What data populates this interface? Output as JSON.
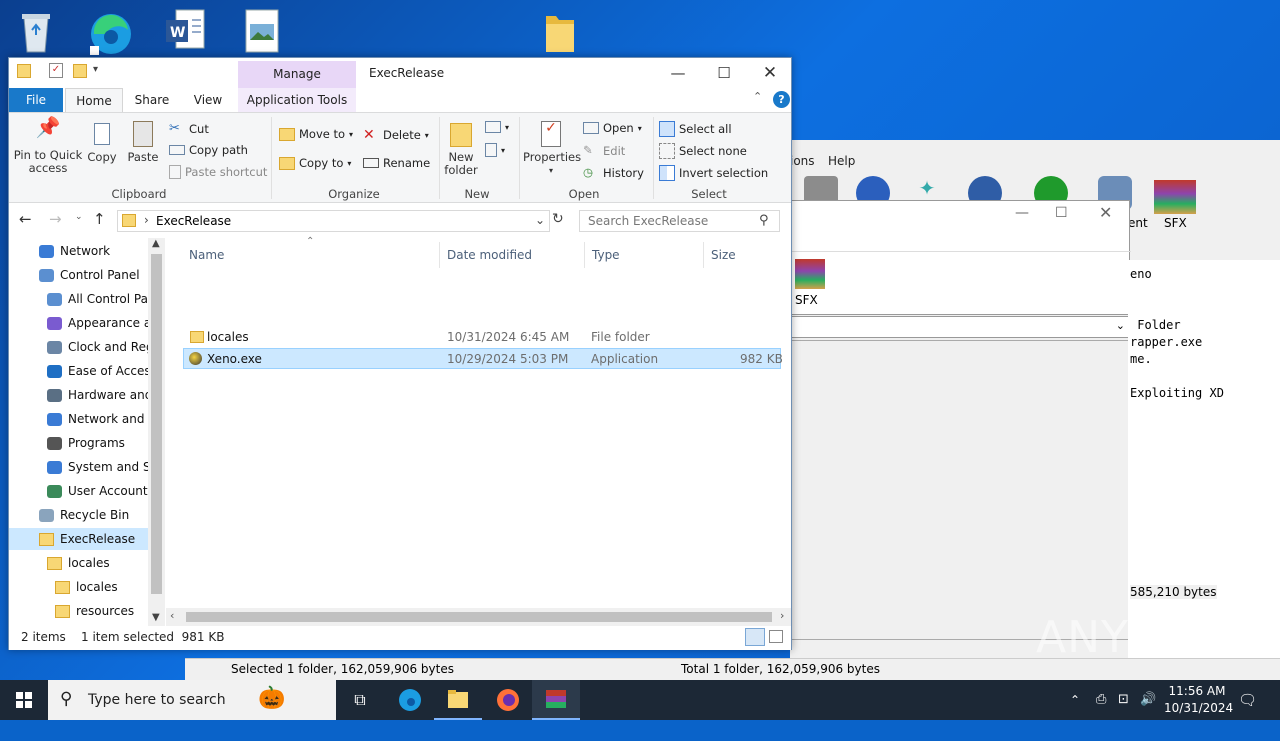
{
  "window": {
    "title": "ExecRelease",
    "manage_label": "Manage"
  },
  "tabs": [
    "File",
    "Home",
    "Share",
    "View",
    "Application Tools"
  ],
  "ribbon": {
    "clipboard": {
      "label": "Clipboard",
      "pin": "Pin to Quick access",
      "copy": "Copy",
      "paste": "Paste",
      "cut": "Cut",
      "copy_path": "Copy path",
      "paste_shortcut": "Paste shortcut"
    },
    "organize": {
      "label": "Organize",
      "move_to": "Move to",
      "copy_to": "Copy to",
      "delete": "Delete",
      "rename": "Rename"
    },
    "new": {
      "label": "New",
      "new_folder": "New folder"
    },
    "open": {
      "label": "Open",
      "properties": "Properties",
      "open": "Open",
      "edit": "Edit",
      "history": "History"
    },
    "select": {
      "label": "Select",
      "select_all": "Select all",
      "select_none": "Select none",
      "invert": "Invert selection"
    }
  },
  "address": {
    "path": "ExecRelease",
    "search_placeholder": "Search ExecRelease"
  },
  "nav": [
    {
      "label": "Network",
      "icon": "network-icon"
    },
    {
      "label": "Control Panel",
      "icon": "control-panel-icon"
    },
    {
      "label": "All Control Par",
      "icon": "control-panel-icon"
    },
    {
      "label": "Appearance an",
      "icon": "appearance-icon"
    },
    {
      "label": "Clock and Regi",
      "icon": "clock-icon"
    },
    {
      "label": "Ease of Access",
      "icon": "ease-of-access-icon"
    },
    {
      "label": "Hardware and",
      "icon": "hardware-icon"
    },
    {
      "label": "Network and Ir",
      "icon": "network-icon"
    },
    {
      "label": "Programs",
      "icon": "programs-icon"
    },
    {
      "label": "System and Sec",
      "icon": "shield-icon"
    },
    {
      "label": "User Accounts",
      "icon": "users-icon"
    },
    {
      "label": "Recycle Bin",
      "icon": "recycle-bin-icon"
    },
    {
      "label": "ExecRelease",
      "icon": "folder-icon"
    },
    {
      "label": "locales",
      "icon": "folder-icon"
    },
    {
      "label": "locales",
      "icon": "folder-icon"
    },
    {
      "label": "resources",
      "icon": "folder-icon"
    }
  ],
  "columns": [
    "Name",
    "Date modified",
    "Type",
    "Size"
  ],
  "files": [
    {
      "name": "locales",
      "date": "10/31/2024 6:45 AM",
      "type": "File folder",
      "size": ""
    },
    {
      "name": "Xeno.exe",
      "date": "10/29/2024 5:03 PM",
      "type": "Application",
      "size": "982 KB"
    }
  ],
  "status": {
    "items": "2 items",
    "selected": "1 item selected  981 KB"
  },
  "back_window": {
    "menu_options": "ions",
    "menu_help": "Help",
    "tool_ent": "ent",
    "tool_sfx": "SFX",
    "inner_sfx": "SFX",
    "text_lines": "eno\n\n\n Folder\nrapper.exe\nme.\n\nExploiting XD",
    "bytes": "585,210 bytes",
    "status_left": "Selected 1 folder, 162,059,906 bytes",
    "status_right": "Total 1 folder, 162,059,906 bytes"
  },
  "taskbar": {
    "search_placeholder": "Type here to search",
    "time": "11:56 AM",
    "date": "10/31/2024"
  },
  "watermark": "ANY RUN"
}
